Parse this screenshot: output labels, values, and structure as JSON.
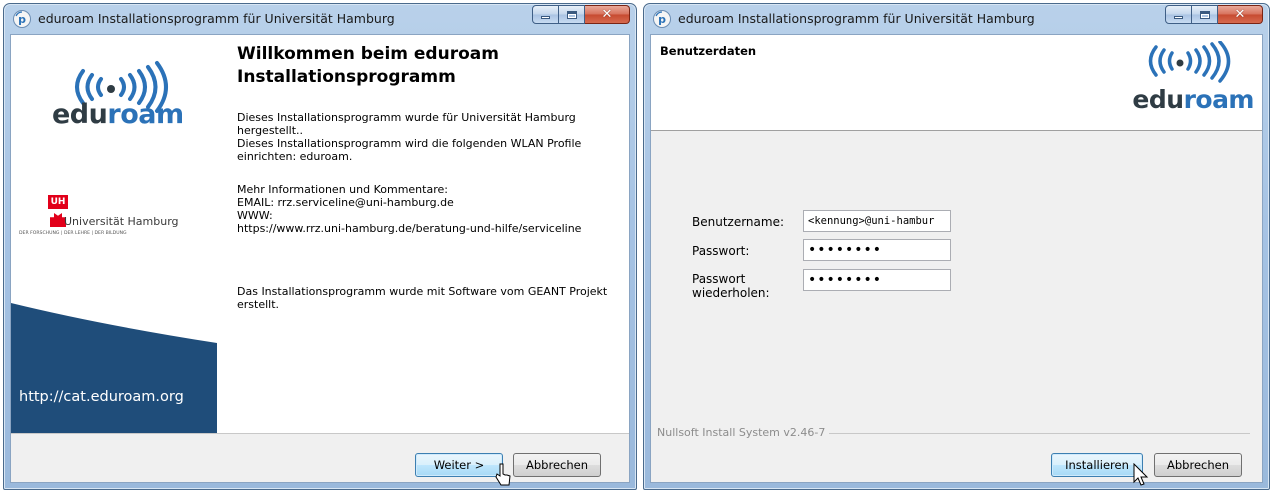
{
  "window1": {
    "title": "eduroam Installationsprogramm für Universität Hamburg",
    "sidebar": {
      "eduroam_logo_text": "eduroam",
      "university_name": "Universität Hamburg",
      "university_tagline": "DER FORSCHUNG | DER LEHRE | DER BILDUNG",
      "url": "http://cat.eduroam.org"
    },
    "heading": "Willkommen beim eduroam Installationsprogramm",
    "paragraph1": "Dieses Installationsprogramm wurde für Universität Hamburg hergestellt..\nDieses Installationsprogramm wird die folgenden WLAN Profile einrichten: eduroam.",
    "paragraph2": "Mehr Informationen und Kommentare:\nEMAIL: rrz.serviceline@uni-hamburg.de\nWWW:\nhttps://www.rrz.uni-hamburg.de/beratung-und-hilfe/serviceline",
    "paragraph3": "Das Installationsprogramm wurde mit Software vom GEANT Projekt erstellt.",
    "next_button": "Weiter >",
    "cancel_button": "Abbrechen"
  },
  "window2": {
    "title": "eduroam Installationsprogramm für Universität Hamburg",
    "header_title": "Benutzerdaten",
    "logo_text": "eduroam",
    "username_label": "Benutzername:",
    "username_value": "<kennung>@uni-hambur",
    "password_label": "Passwort:",
    "password_value": "••••••••",
    "password_repeat_label": "Passwort\nwiederholen:",
    "password_repeat_value": "••••••••",
    "nsis_label": "Nullsoft Install System v2.46-7",
    "install_button": "Installieren",
    "cancel_button": "Abbrechen"
  },
  "colors": {
    "eduroam_grey": "#2f3c44",
    "eduroam_blue": "#2b72b8",
    "uhh_red": "#e2001a",
    "sidebar_navy": "#1f4d7a"
  }
}
